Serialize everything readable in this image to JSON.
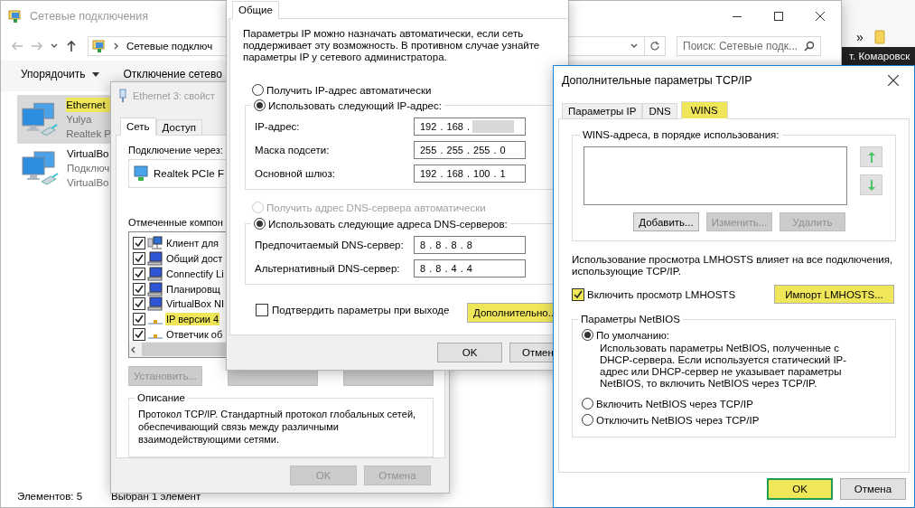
{
  "explorer": {
    "title": "Сетевые подключения",
    "address": "Сетевые подключ",
    "search": {
      "placeholder": "Поиск: Сетевые подк..."
    },
    "toolbar": [
      {
        "label": "Упорядочить",
        "kind": "menu"
      },
      {
        "label": "Отключение сетево",
        "kind": "command"
      }
    ],
    "items": [
      {
        "name": "Ethernet",
        "lines": [
          "Yulya",
          "Realtek P"
        ],
        "selected": true,
        "highlighted": true
      },
      {
        "name": "VirtualBo",
        "lines": [
          "Подключ",
          "VirtualBo"
        ],
        "selected": false,
        "highlighted": false
      }
    ],
    "status": [
      "Элементов: 5",
      "Выбран 1 элемент"
    ]
  },
  "browser": {
    "overflow": "»",
    "tab_text": "т. Комаровск"
  },
  "ethernet_props": {
    "title": "Ethernet 3: свойст",
    "tabs": [
      {
        "label": "Сеть",
        "selected": true
      },
      {
        "label": "Доступ",
        "selected": false
      }
    ],
    "connect_label": "Подключение через:",
    "adapter": "Realtek PCIe F",
    "components_label": "Отмеченные компон",
    "components": [
      {
        "label": "Клиент для",
        "kind": "client",
        "checked": true,
        "highlighted": false
      },
      {
        "label": "Общий дост",
        "kind": "service",
        "checked": true,
        "highlighted": false
      },
      {
        "label": "Connectify Li",
        "kind": "service",
        "checked": true,
        "highlighted": false
      },
      {
        "label": "Планировщ",
        "kind": "service",
        "checked": true,
        "highlighted": false
      },
      {
        "label": "VirtualBox NI",
        "kind": "service",
        "checked": true,
        "highlighted": false
      },
      {
        "label": "IP версии 4",
        "kind": "protocol",
        "checked": true,
        "highlighted": true
      },
      {
        "label": "Ответчик об",
        "kind": "protocol",
        "checked": true,
        "highlighted": false
      }
    ],
    "install_button": {
      "label": "Установить...",
      "disabled": true
    },
    "description": {
      "title": "Описание",
      "text": "Протокол TCP/IP. Стандартный протокол глобальных сетей, обеспечивающий связь между различными взаимодействующими сетями."
    },
    "footer": [
      {
        "label": "OK",
        "disabled": true
      },
      {
        "label": "Отмена",
        "disabled": true
      }
    ]
  },
  "ipv4": {
    "tabs": [
      {
        "label": "Общие",
        "selected": true
      }
    ],
    "intro": "Параметры IP можно назначать автоматически, если сеть поддерживает эту возможность. В противном случае узнайте параметры IP у сетевого администратора.",
    "ip_mode": [
      {
        "label": "Получить IP-адрес автоматически",
        "selected": false,
        "disabled": false
      },
      {
        "label": "Использовать следующий IP-адрес:",
        "selected": true,
        "disabled": false
      }
    ],
    "ip_fields": [
      {
        "label": "IP-адрес:",
        "value": "192 . 168 .",
        "redacted": true
      },
      {
        "label": "Маска подсети:",
        "value": "255 . 255 . 255 . 0",
        "redacted": false
      },
      {
        "label": "Основной шлюз:",
        "value": "192 . 168 . 100 . 1",
        "redacted": false
      }
    ],
    "dns_mode": [
      {
        "label": "Получить адрес DNS-сервера автоматически",
        "selected": false,
        "disabled": true
      },
      {
        "label": "Использовать следующие адреса DNS-серверов:",
        "selected": true,
        "disabled": false
      }
    ],
    "dns_fields": [
      {
        "label": "Предпочитаемый DNS-сервер:",
        "value": "8 . 8 . 8 . 8",
        "redacted": false
      },
      {
        "label": "Альтернативный DNS-сервер:",
        "value": "8 . 8 . 4 . 4",
        "redacted": false
      }
    ],
    "confirm": {
      "label": "Подтвердить параметры при выходе",
      "checked": false
    },
    "advanced_button": {
      "label": "Дополнительно..",
      "highlighted": true
    },
    "footer": [
      {
        "label": "OK"
      },
      {
        "label": "Отмен"
      }
    ]
  },
  "advanced": {
    "title": "Дополнительные параметры TCP/IP",
    "tabs": [
      {
        "label": "Параметры IP",
        "selected": false,
        "highlighted": false
      },
      {
        "label": "DNS",
        "selected": false,
        "highlighted": false
      },
      {
        "label": "WINS",
        "selected": true,
        "highlighted": true
      }
    ],
    "wins_group": {
      "title": "WINS-адреса, в порядке использования:",
      "buttons": [
        {
          "label": "Добавить...",
          "disabled": false
        },
        {
          "label": "Изменить...",
          "disabled": true
        },
        {
          "label": "Удалить",
          "disabled": true
        }
      ]
    },
    "lmhosts_note": "Использование просмотра LMHOSTS влияет на все подключения, использующие TCP/IP.",
    "lmhosts": {
      "label": "Включить просмотр LMHOSTS",
      "checked": true,
      "highlighted": true
    },
    "import_button": {
      "label": "Импорт LMHOSTS...",
      "highlighted": true
    },
    "netbios": {
      "title": "Параметры NetBIOS",
      "options": [
        {
          "label": "По умолчанию:",
          "selected": true,
          "note": "Использовать параметры NetBIOS, полученные с DHCP-сервера. Если используется статический IP-адрес или DHCP-сервер не указывает параметры NetBIOS, то включить NetBIOS через TCP/IP."
        },
        {
          "label": "Включить NetBIOS через TCP/IP",
          "selected": false
        },
        {
          "label": "Отключить NetBIOS через TCP/IP",
          "selected": false
        }
      ]
    },
    "footer": [
      {
        "label": "OK",
        "highlighted": true
      },
      {
        "label": "Отмена",
        "highlighted": false
      }
    ]
  }
}
